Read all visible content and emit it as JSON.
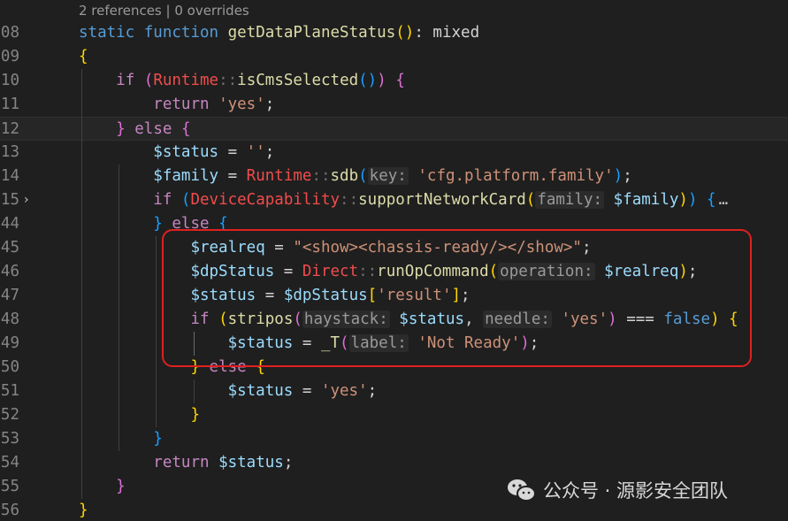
{
  "codelens": "2 references | 0 overrides",
  "lines": [
    {
      "n": "08",
      "tokens": [
        [
          "kw",
          "static"
        ],
        [
          "op",
          " "
        ],
        [
          "kw",
          "function"
        ],
        [
          "op",
          " "
        ],
        [
          "fn",
          "getDataPlaneStatus"
        ],
        [
          "b1",
          "()"
        ],
        [
          "op",
          ": "
        ],
        [
          "op",
          "mixed"
        ]
      ]
    },
    {
      "n": "09",
      "tokens": [
        [
          "b1",
          "{"
        ]
      ]
    },
    {
      "n": "10",
      "tokens": [
        [
          "op",
          "    "
        ],
        [
          "ctl",
          "if"
        ],
        [
          "op",
          " "
        ],
        [
          "b2",
          "("
        ],
        [
          "cls",
          "Runtime"
        ],
        [
          "dim",
          "::"
        ],
        [
          "fn",
          "isCmsSelected"
        ],
        [
          "b3",
          "()"
        ],
        [
          "b2",
          ")"
        ],
        [
          "op",
          " "
        ],
        [
          "b2",
          "{"
        ]
      ]
    },
    {
      "n": "11",
      "tokens": [
        [
          "op",
          "        "
        ],
        [
          "ctl",
          "return"
        ],
        [
          "op",
          " "
        ],
        [
          "str",
          "'yes'"
        ],
        [
          "op",
          ";"
        ]
      ]
    },
    {
      "n": "12",
      "tokens": [
        [
          "op",
          "    "
        ],
        [
          "b2",
          "}"
        ],
        [
          "op",
          " "
        ],
        [
          "ctl",
          "else"
        ],
        [
          "op",
          " "
        ],
        [
          "b2",
          "{"
        ]
      ]
    },
    {
      "n": "13",
      "tokens": [
        [
          "op",
          "        "
        ],
        [
          "var",
          "$status"
        ],
        [
          "op",
          " = "
        ],
        [
          "str",
          "''"
        ],
        [
          "op",
          ";"
        ]
      ]
    },
    {
      "n": "14",
      "tokens": [
        [
          "op",
          "        "
        ],
        [
          "var",
          "$family"
        ],
        [
          "op",
          " = "
        ],
        [
          "cls",
          "Runtime"
        ],
        [
          "dim",
          "::"
        ],
        [
          "fn",
          "sdb"
        ],
        [
          "b3",
          "("
        ],
        [
          "hint",
          "key:"
        ],
        [
          "op",
          " "
        ],
        [
          "str",
          "'cfg.platform.family'"
        ],
        [
          "b3",
          ")"
        ],
        [
          "op",
          ";"
        ]
      ]
    },
    {
      "n": "15",
      "tokens": [
        [
          "op",
          "        "
        ],
        [
          "ctl",
          "if"
        ],
        [
          "op",
          " "
        ],
        [
          "b3",
          "("
        ],
        [
          "cls",
          "DeviceCapability"
        ],
        [
          "dim",
          "::"
        ],
        [
          "fn",
          "supportNetworkCard"
        ],
        [
          "b1",
          "("
        ],
        [
          "hint",
          "family:"
        ],
        [
          "op",
          " "
        ],
        [
          "var",
          "$family"
        ],
        [
          "b1",
          ")"
        ],
        [
          "b3",
          ")"
        ],
        [
          "op",
          " "
        ],
        [
          "b3",
          "{"
        ]
      ]
    },
    {
      "n": "44",
      "tokens": [
        [
          "op",
          "        "
        ],
        [
          "b3",
          "}"
        ],
        [
          "op",
          " "
        ],
        [
          "ctl",
          "else"
        ],
        [
          "op",
          " "
        ],
        [
          "b3",
          "{"
        ]
      ]
    },
    {
      "n": "45",
      "tokens": [
        [
          "op",
          "            "
        ],
        [
          "var",
          "$realreq"
        ],
        [
          "op",
          " = "
        ],
        [
          "str",
          "\"<show><chassis-ready/></show>\""
        ],
        [
          "op",
          ";"
        ]
      ]
    },
    {
      "n": "46",
      "tokens": [
        [
          "op",
          "            "
        ],
        [
          "var",
          "$dpStatus"
        ],
        [
          "op",
          " = "
        ],
        [
          "cls",
          "Direct"
        ],
        [
          "dim",
          "::"
        ],
        [
          "fn",
          "runOpCommand"
        ],
        [
          "b1",
          "("
        ],
        [
          "hint",
          "operation:"
        ],
        [
          "op",
          " "
        ],
        [
          "var",
          "$realreq"
        ],
        [
          "b1",
          ")"
        ],
        [
          "op",
          ";"
        ]
      ]
    },
    {
      "n": "47",
      "tokens": [
        [
          "op",
          "            "
        ],
        [
          "var",
          "$status"
        ],
        [
          "op",
          " = "
        ],
        [
          "var",
          "$dpStatus"
        ],
        [
          "b1",
          "["
        ],
        [
          "str",
          "'result'"
        ],
        [
          "b1",
          "]"
        ],
        [
          "op",
          ";"
        ]
      ]
    },
    {
      "n": "48",
      "tokens": [
        [
          "op",
          "            "
        ],
        [
          "ctl",
          "if"
        ],
        [
          "op",
          " "
        ],
        [
          "b1",
          "("
        ],
        [
          "fn",
          "stripos"
        ],
        [
          "b2",
          "("
        ],
        [
          "hint",
          "haystack:"
        ],
        [
          "op",
          " "
        ],
        [
          "var",
          "$status"
        ],
        [
          "op",
          ", "
        ],
        [
          "hint",
          "needle:"
        ],
        [
          "op",
          " "
        ],
        [
          "str",
          "'yes'"
        ],
        [
          "b2",
          ")"
        ],
        [
          "op",
          " === "
        ],
        [
          "kw",
          "false"
        ],
        [
          "b1",
          ")"
        ],
        [
          "op",
          " "
        ],
        [
          "b1",
          "{"
        ]
      ]
    },
    {
      "n": "49",
      "tokens": [
        [
          "op",
          "                "
        ],
        [
          "var",
          "$status"
        ],
        [
          "op",
          " = "
        ],
        [
          "fn",
          "_T"
        ],
        [
          "b2",
          "("
        ],
        [
          "hint",
          "label:"
        ],
        [
          "op",
          " "
        ],
        [
          "str",
          "'Not Ready'"
        ],
        [
          "b2",
          ")"
        ],
        [
          "op",
          ";"
        ]
      ]
    },
    {
      "n": "50",
      "tokens": [
        [
          "op",
          "            "
        ],
        [
          "b1",
          "}"
        ],
        [
          "op",
          " "
        ],
        [
          "ctl",
          "else"
        ],
        [
          "op",
          " "
        ],
        [
          "b1",
          "{"
        ]
      ]
    },
    {
      "n": "51",
      "tokens": [
        [
          "op",
          "                "
        ],
        [
          "var",
          "$status"
        ],
        [
          "op",
          " = "
        ],
        [
          "str",
          "'yes'"
        ],
        [
          "op",
          ";"
        ]
      ]
    },
    {
      "n": "52",
      "tokens": [
        [
          "op",
          "            "
        ],
        [
          "b1",
          "}"
        ]
      ]
    },
    {
      "n": "53",
      "tokens": [
        [
          "op",
          "        "
        ],
        [
          "b3",
          "}"
        ]
      ]
    },
    {
      "n": "54",
      "tokens": [
        [
          "op",
          "        "
        ],
        [
          "ctl",
          "return"
        ],
        [
          "op",
          " "
        ],
        [
          "var",
          "$status"
        ],
        [
          "op",
          ";"
        ]
      ]
    },
    {
      "n": "55",
      "tokens": [
        [
          "op",
          "    "
        ],
        [
          "b2",
          "}"
        ]
      ]
    },
    {
      "n": "56",
      "tokens": [
        [
          "b1",
          "}"
        ]
      ]
    }
  ],
  "current_line": "12",
  "folded_line": "15",
  "fold_icon": "chevron-right-icon",
  "folded_ellipsis": "…",
  "watermark": {
    "logo": "wechat-logo-icon",
    "text": "公众号 · 源影安全团队"
  },
  "colors": {
    "background": "#1f1f1f",
    "highlight_box": "#e02020"
  }
}
